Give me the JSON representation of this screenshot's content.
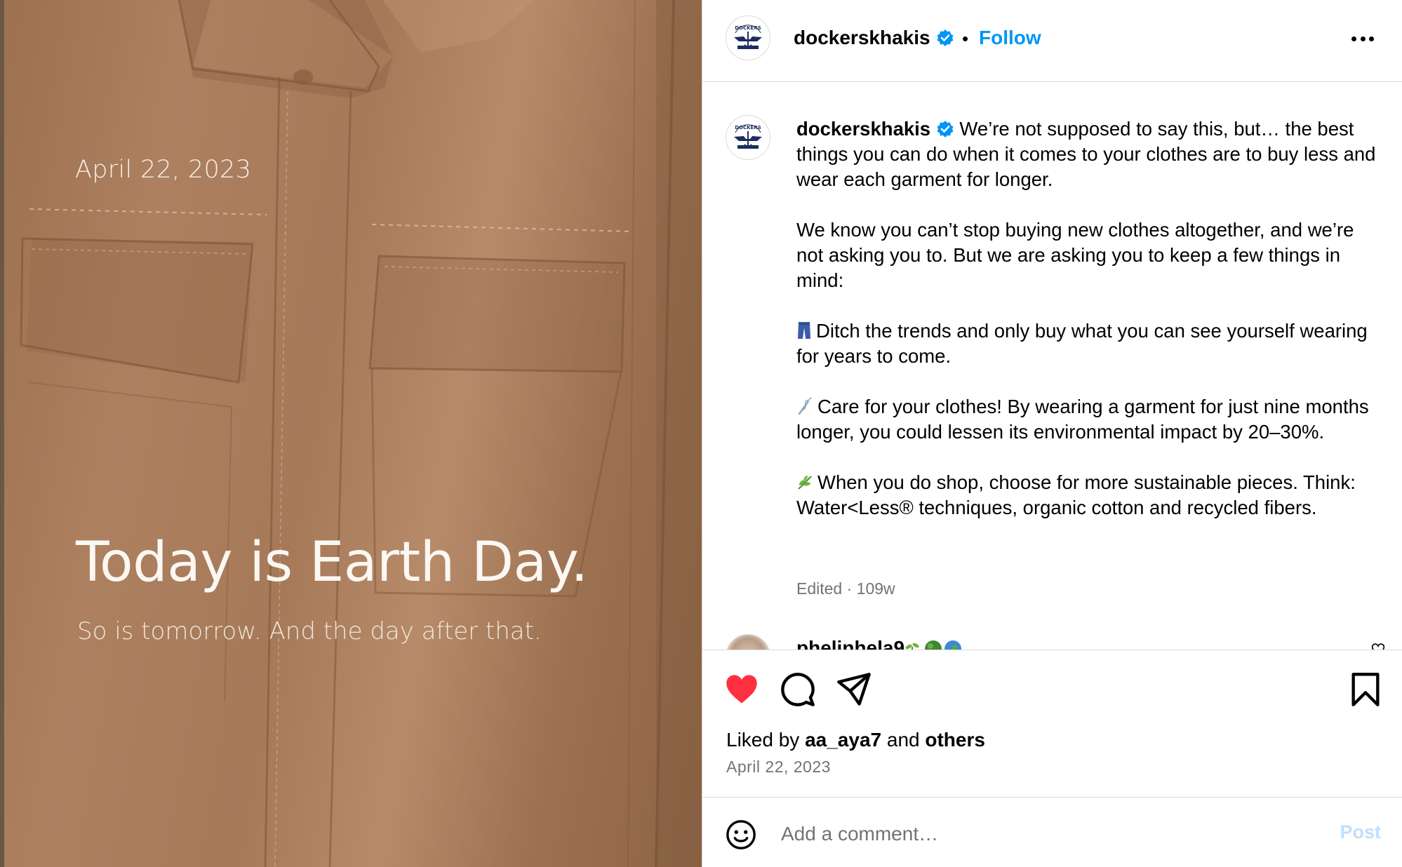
{
  "media": {
    "date_overlay": "April 22, 2023",
    "headline": "Today is Earth Day.",
    "subline": "So is tomorrow. And the day after that."
  },
  "header": {
    "username": "dockerskhakis",
    "separator": "•",
    "follow_label": "Follow",
    "more_icon": "more-horizontal-icon"
  },
  "caption": {
    "username": "dockerskhakis",
    "paragraphs": [
      "We’re not supposed to say this, but… the best things you can do when it comes to your clothes are to buy less and wear each garment for longer.",
      "We know you can’t stop buying new clothes altogether, and we’re not asking you to. But we are asking you to keep a few things in mind:",
      "Ditch the trends and only buy what you can see yourself wearing for years to come.",
      "Care for your clothes! By wearing a garment for just nine months longer, you could lessen its environmental impact by 20–30%.",
      "When you do shop, choose for more sustainable pieces. Think: Water<Less® techniques, organic cotton and recycled fibers."
    ],
    "meta": "Edited · 109w"
  },
  "next_comment": {
    "username": "phelinhela9"
  },
  "actions": {
    "like_icon": "heart-icon",
    "comment_icon": "comment-icon",
    "share_icon": "send-icon",
    "save_icon": "bookmark-icon",
    "liked_prefix": "Liked by",
    "liked_user": "aa_aya7",
    "liked_and": "and",
    "liked_others": "others",
    "date": "April 22, 2023"
  },
  "comment_bar": {
    "placeholder": "Add a comment…",
    "post_label": "Post"
  },
  "colors": {
    "accent": "#0095f6",
    "like_red": "#ff3040",
    "muted": "#737373",
    "post_disabled": "#c0dffd"
  }
}
